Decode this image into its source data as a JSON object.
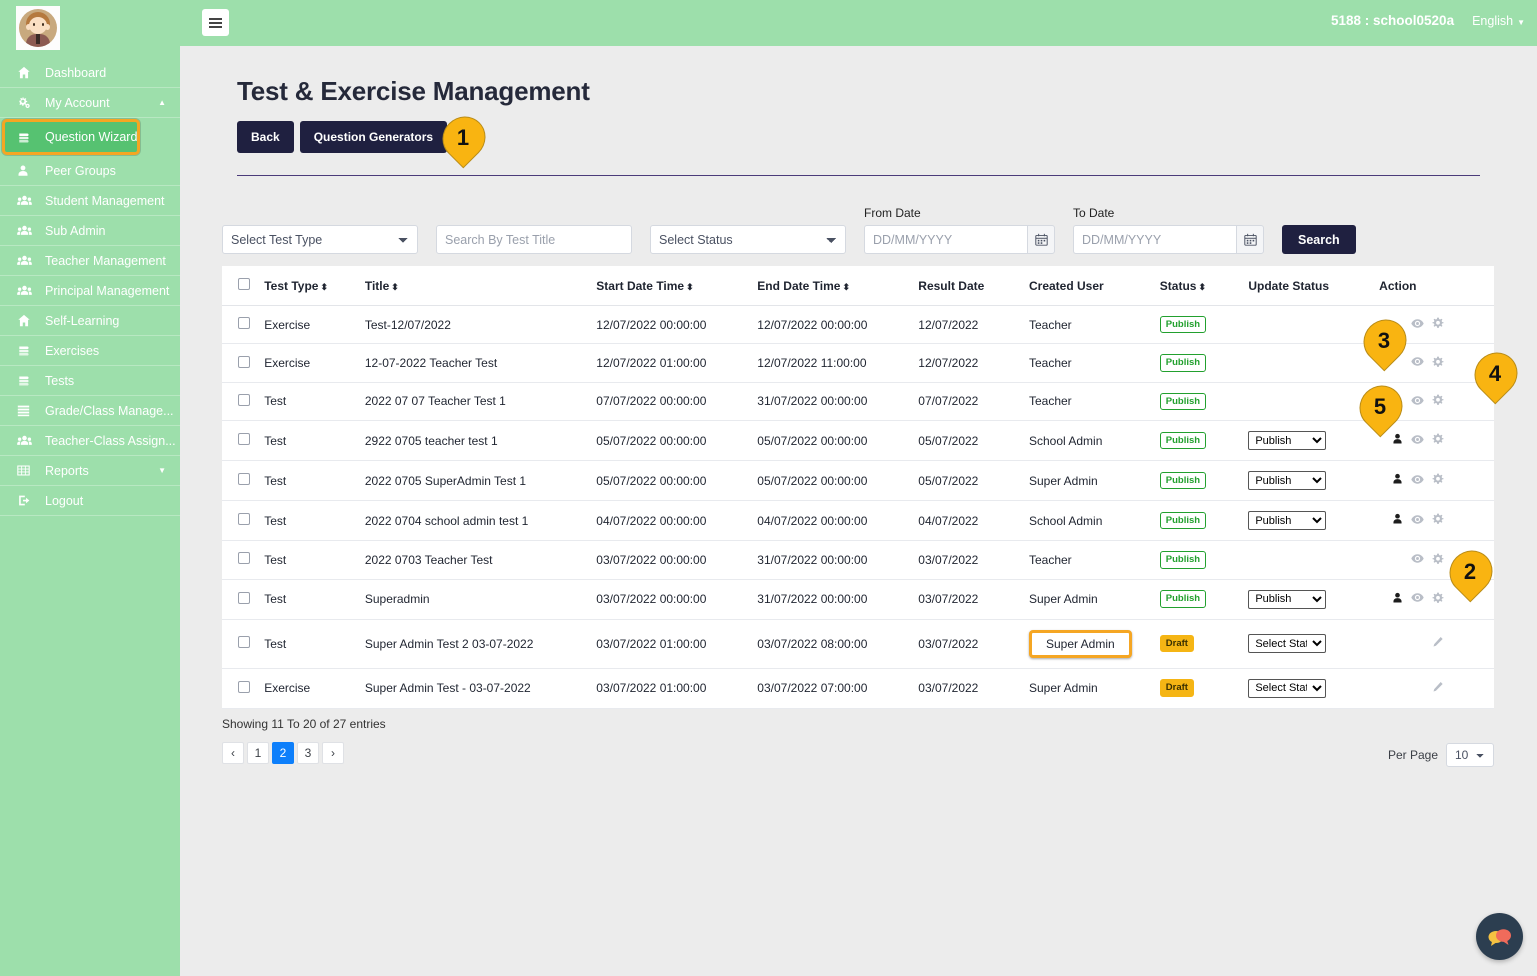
{
  "topbar": {
    "menu_icon": "hamburger-icon",
    "school": "5188 : school0520a",
    "language": "English"
  },
  "sidebar": {
    "avatar_alt": "user-avatar",
    "items": [
      {
        "label": "Dashboard",
        "icon": "home-icon"
      },
      {
        "label": "My Account",
        "icon": "gears-icon",
        "caret": "▲"
      },
      {
        "label": "Question Wizard",
        "icon": "book-icon",
        "active": true
      },
      {
        "label": "Peer Groups",
        "icon": "user-icon"
      },
      {
        "label": "Student Management",
        "icon": "users-icon"
      },
      {
        "label": "Sub Admin",
        "icon": "users-icon"
      },
      {
        "label": "Teacher Management",
        "icon": "users-icon"
      },
      {
        "label": "Principal Management",
        "icon": "users-icon"
      },
      {
        "label": "Self-Learning",
        "icon": "home-icon"
      },
      {
        "label": "Exercises",
        "icon": "book-icon"
      },
      {
        "label": "Tests",
        "icon": "book-icon"
      },
      {
        "label": "Grade/Class Manage...",
        "icon": "list-icon"
      },
      {
        "label": "Teacher-Class Assign...",
        "icon": "users-icon"
      },
      {
        "label": "Reports",
        "icon": "table-icon",
        "caret": "▼"
      },
      {
        "label": "Logout",
        "icon": "logout-icon"
      }
    ]
  },
  "page": {
    "title": "Test & Exercise Management",
    "back_label": "Back",
    "question_generators_label": "Question Generators"
  },
  "filters": {
    "test_type_selected": "Select Test Type",
    "search_title_placeholder": "Search By Test Title",
    "status_selected": "Select Status",
    "from_date_label": "From Date",
    "from_date_placeholder": "DD/MM/YYYY",
    "to_date_label": "To Date",
    "to_date_placeholder": "DD/MM/YYYY",
    "search_label": "Search"
  },
  "table": {
    "headers": [
      {
        "label": "",
        "sortable": false
      },
      {
        "label": "Test Type",
        "sortable": true
      },
      {
        "label": "Title",
        "sortable": true
      },
      {
        "label": "Start Date Time",
        "sortable": true
      },
      {
        "label": "End Date Time",
        "sortable": true
      },
      {
        "label": "Result Date",
        "sortable": false
      },
      {
        "label": "Created User",
        "sortable": false
      },
      {
        "label": "Status",
        "sortable": true
      },
      {
        "label": "Update Status",
        "sortable": false
      },
      {
        "label": "Action",
        "sortable": false
      }
    ],
    "rows": [
      {
        "test_type": "Exercise",
        "title": "Test-12/07/2022",
        "start": "12/07/2022 00:00:00",
        "end": "12/07/2022 00:00:00",
        "result": "12/07/2022",
        "user": "Teacher",
        "status": "Publish",
        "update_status": null,
        "actions": [
          "eye-icon",
          "gear-icon"
        ],
        "highlight_user": false
      },
      {
        "test_type": "Exercise",
        "title": "12-07-2022 Teacher Test",
        "start": "12/07/2022 01:00:00",
        "end": "12/07/2022 11:00:00",
        "result": "12/07/2022",
        "user": "Teacher",
        "status": "Publish",
        "update_status": null,
        "actions": [
          "eye-icon",
          "gear-icon"
        ],
        "highlight_user": false
      },
      {
        "test_type": "Test",
        "title": "2022 07 07 Teacher Test 1",
        "start": "07/07/2022 00:00:00",
        "end": "31/07/2022 00:00:00",
        "result": "07/07/2022",
        "user": "Teacher",
        "status": "Publish",
        "update_status": null,
        "actions": [
          "eye-icon",
          "gear-icon"
        ],
        "highlight_user": false
      },
      {
        "test_type": "Test",
        "title": "2922 0705 teacher test 1",
        "start": "05/07/2022 00:00:00",
        "end": "05/07/2022 00:00:00",
        "result": "05/07/2022",
        "user": "School Admin",
        "status": "Publish",
        "update_status": "Publish",
        "actions": [
          "user-icon",
          "eye-icon",
          "gear-icon"
        ],
        "highlight_user": false
      },
      {
        "test_type": "Test",
        "title": "2022 0705 SuperAdmin Test 1",
        "start": "05/07/2022 00:00:00",
        "end": "05/07/2022 00:00:00",
        "result": "05/07/2022",
        "user": "Super Admin",
        "status": "Publish",
        "update_status": "Publish",
        "actions": [
          "user-icon",
          "eye-icon",
          "gear-icon"
        ],
        "highlight_user": false
      },
      {
        "test_type": "Test",
        "title": "2022 0704 school admin test 1",
        "start": "04/07/2022 00:00:00",
        "end": "04/07/2022 00:00:00",
        "result": "04/07/2022",
        "user": "School Admin",
        "status": "Publish",
        "update_status": "Publish",
        "actions": [
          "user-icon",
          "eye-icon",
          "gear-icon"
        ],
        "highlight_user": false
      },
      {
        "test_type": "Test",
        "title": "2022 0703 Teacher Test",
        "start": "03/07/2022 00:00:00",
        "end": "31/07/2022 00:00:00",
        "result": "03/07/2022",
        "user": "Teacher",
        "status": "Publish",
        "update_status": null,
        "actions": [
          "eye-icon",
          "gear-icon"
        ],
        "highlight_user": false
      },
      {
        "test_type": "Test",
        "title": "Superadmin",
        "start": "03/07/2022 00:00:00",
        "end": "31/07/2022 00:00:00",
        "result": "03/07/2022",
        "user": "Super Admin",
        "status": "Publish",
        "update_status": "Publish",
        "actions": [
          "user-icon",
          "eye-icon",
          "gear-icon"
        ],
        "highlight_user": false
      },
      {
        "test_type": "Test",
        "title": "Super Admin Test 2 03-07-2022",
        "start": "03/07/2022 01:00:00",
        "end": "03/07/2022 08:00:00",
        "result": "03/07/2022",
        "user": "Super Admin",
        "status": "Draft",
        "update_status": "Select Status",
        "actions": [
          "pencil-icon"
        ],
        "highlight_user": true
      },
      {
        "test_type": "Exercise",
        "title": "Super Admin Test - 03-07-2022",
        "start": "03/07/2022 01:00:00",
        "end": "03/07/2022 07:00:00",
        "result": "03/07/2022",
        "user": "Super Admin",
        "status": "Draft",
        "update_status": "Select Status",
        "actions": [
          "pencil-icon"
        ],
        "highlight_user": false
      }
    ]
  },
  "footer": {
    "showing": "Showing 11 To 20 of 27 entries",
    "pages": [
      "‹",
      "1",
      "2",
      "3",
      "›"
    ],
    "active_page": "2",
    "per_page_label": "Per Page",
    "per_page_value": "10"
  },
  "callouts": [
    {
      "num": "1"
    },
    {
      "num": "2"
    },
    {
      "num": "3"
    },
    {
      "num": "4"
    },
    {
      "num": "5"
    }
  ],
  "chat": {
    "icon": "chat-bubbles-icon"
  },
  "colors": {
    "sidebar_bg": "#9ddfab",
    "sidebar_active": "#56c271",
    "highlight": "#f5a623",
    "dark_button": "#1f2040",
    "publish": "#22a02e",
    "draft": "#f5b514",
    "pager_active": "#0d7ffb"
  }
}
